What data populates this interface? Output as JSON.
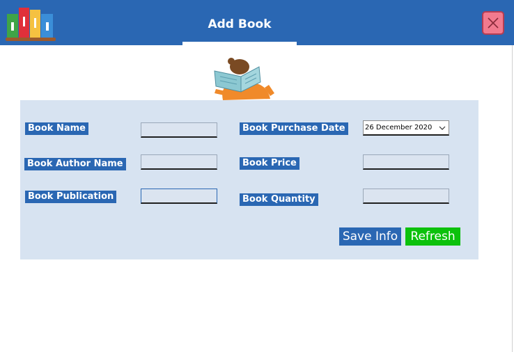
{
  "window": {
    "title": "Add Book"
  },
  "form": {
    "book_name": {
      "label": "Book Name",
      "value": ""
    },
    "book_author_name": {
      "label": "Book Author Name",
      "value": ""
    },
    "book_publication": {
      "label": "Book Publication",
      "value": ""
    },
    "book_purchase_date": {
      "label": "Book Purchase Date",
      "value": "26 December 2020"
    },
    "book_price": {
      "label": "Book Price",
      "value": ""
    },
    "book_quantity": {
      "label": "Book Quantity",
      "value": ""
    }
  },
  "actions": {
    "save_label": "Save Info",
    "refresh_label": "Refresh"
  },
  "colors": {
    "header": "#2a67b3",
    "panel": "#d7e3f1",
    "label_bg": "#2a67b3",
    "save_button": "#2a67b3",
    "refresh_button": "#0cc10c",
    "close_button": "#f27a8e"
  },
  "icons": {
    "logo": "books-icon",
    "illustration": "reading-person-icon",
    "close": "close-icon",
    "dropdown": "chevron-down-icon"
  }
}
